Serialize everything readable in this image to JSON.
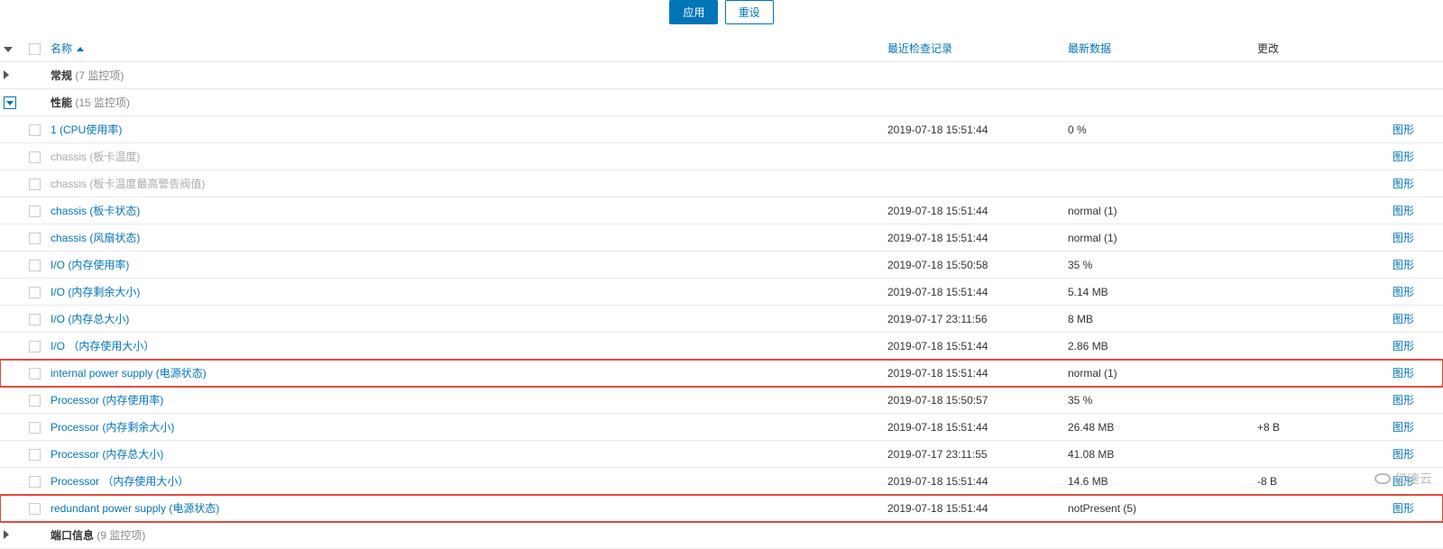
{
  "buttons": {
    "apply": "应用",
    "reset": "重设"
  },
  "headers": {
    "name": "名称",
    "lastCheck": "最近检查记录",
    "latest": "最新数据",
    "change": "更改"
  },
  "graphLabel": "图形",
  "groups": {
    "general": {
      "label": "常规",
      "count": "(7 监控项)"
    },
    "performance": {
      "label": "性能",
      "count": "(15 监控项)"
    },
    "port": {
      "label": "端口信息",
      "count": "(9 监控项)"
    }
  },
  "items": [
    {
      "name": "1 (CPU使用率)",
      "check": "2019-07-18 15:51:44",
      "latest": "0 %",
      "change": "",
      "disabled": false,
      "hl": false
    },
    {
      "name": "chassis (板卡温度)",
      "check": "",
      "latest": "",
      "change": "",
      "disabled": true,
      "hl": false
    },
    {
      "name": "chassis (板卡温度最高警告阀值)",
      "check": "",
      "latest": "",
      "change": "",
      "disabled": true,
      "hl": false
    },
    {
      "name": "chassis (板卡状态)",
      "check": "2019-07-18 15:51:44",
      "latest": "normal (1)",
      "change": "",
      "disabled": false,
      "hl": false
    },
    {
      "name": "chassis (风扇状态)",
      "check": "2019-07-18 15:51:44",
      "latest": "normal (1)",
      "change": "",
      "disabled": false,
      "hl": false
    },
    {
      "name": "I/O (内存使用率)",
      "check": "2019-07-18 15:50:58",
      "latest": "35 %",
      "change": "",
      "disabled": false,
      "hl": false
    },
    {
      "name": "I/O (内存剩余大小)",
      "check": "2019-07-18 15:51:44",
      "latest": "5.14 MB",
      "change": "",
      "disabled": false,
      "hl": false
    },
    {
      "name": "I/O (内存总大小)",
      "check": "2019-07-17 23:11:56",
      "latest": "8 MB",
      "change": "",
      "disabled": false,
      "hl": false
    },
    {
      "name": "I/O （内存使用大小）",
      "check": "2019-07-18 15:51:44",
      "latest": "2.86 MB",
      "change": "",
      "disabled": false,
      "hl": false
    },
    {
      "name": "internal power supply (电源状态)",
      "check": "2019-07-18 15:51:44",
      "latest": "normal (1)",
      "change": "",
      "disabled": false,
      "hl": true
    },
    {
      "name": "Processor (内存使用率)",
      "check": "2019-07-18 15:50:57",
      "latest": "35 %",
      "change": "",
      "disabled": false,
      "hl": false
    },
    {
      "name": "Processor (内存剩余大小)",
      "check": "2019-07-18 15:51:44",
      "latest": "26.48 MB",
      "change": "+8 B",
      "disabled": false,
      "hl": false
    },
    {
      "name": "Processor (内存总大小)",
      "check": "2019-07-17 23:11:55",
      "latest": "41.08 MB",
      "change": "",
      "disabled": false,
      "hl": false
    },
    {
      "name": "Processor （内存使用大小）",
      "check": "2019-07-18 15:51:44",
      "latest": "14.6 MB",
      "change": "-8 B",
      "disabled": false,
      "hl": false
    },
    {
      "name": "redundant power supply (电源状态)",
      "check": "2019-07-18 15:51:44",
      "latest": "notPresent (5)",
      "change": "",
      "disabled": false,
      "hl": true
    }
  ],
  "watermark": "亿速云"
}
